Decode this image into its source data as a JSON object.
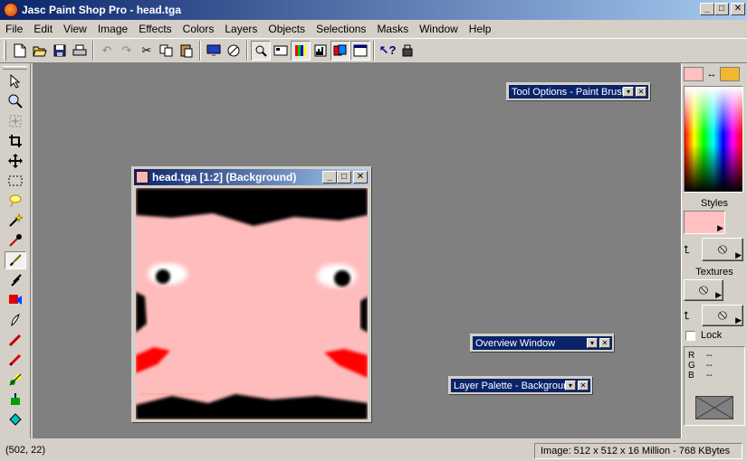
{
  "window": {
    "title": "Jasc Paint Shop Pro - head.tga",
    "min_glyph": "_",
    "max_glyph": "□",
    "close_glyph": "✕"
  },
  "menu": [
    "File",
    "Edit",
    "View",
    "Image",
    "Effects",
    "Colors",
    "Layers",
    "Objects",
    "Selections",
    "Masks",
    "Window",
    "Help"
  ],
  "toolbar_icons": [
    "new-icon",
    "open-icon",
    "save-icon",
    "print-icon",
    "undo-icon",
    "redo-icon",
    "cut-icon",
    "copy-icon",
    "paste-icon",
    "full-screen-preview-icon",
    "browse-icon",
    "tool-options-icon",
    "overview-icon",
    "color-palette-icon",
    "histogram-icon",
    "layer-palette-icon",
    "toolbar-toggle-icon",
    "context-help-icon",
    "script-icon"
  ],
  "tools": [
    "arrow-tool-icon",
    "zoom-tool-icon",
    "deform-tool-icon",
    "crop-tool-icon",
    "mover-tool-icon",
    "selection-tool-icon",
    "freehand-selection-icon",
    "magic-wand-icon",
    "dropper-tool-icon",
    "paint-brush-icon",
    "clone-brush-icon",
    "color-replacer-icon",
    "retouch-tool-icon",
    "scratch-remover-icon",
    "eraser-tool-icon",
    "picture-tube-icon",
    "airbrush-icon",
    "flood-fill-icon"
  ],
  "active_tool": "paint-brush-icon",
  "image_window": {
    "title": "head.tga [1:2] (Background)"
  },
  "floating_palettes": {
    "tool_options": "Tool Options - Paint Brush",
    "overview": "Overview Window",
    "layer_palette": "Layer Palette - Background"
  },
  "right_panel": {
    "styles_label": "Styles",
    "textures_label": "Textures",
    "lock_label": "Lock",
    "foreground_color": "#ffc0c0",
    "background_color": "#f0b830",
    "rgb": [
      {
        "label": "R",
        "value": "--"
      },
      {
        "label": "G",
        "value": "--"
      },
      {
        "label": "B",
        "value": "--"
      }
    ]
  },
  "status": {
    "cursor": "(502, 22)",
    "image_info": "Image:  512 x 512 x 16 Million - 768 KBytes"
  }
}
